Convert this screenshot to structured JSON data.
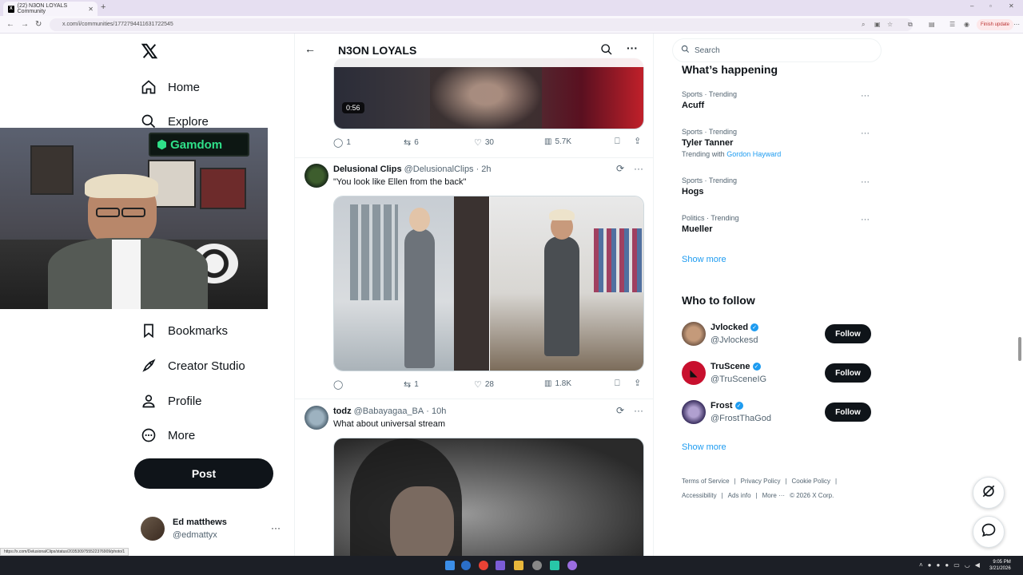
{
  "browser": {
    "tab_title": "(22) N3ON LOYALS Community",
    "url": "x.com/i/communities/1772794411631722545",
    "finish_update": "Finish update"
  },
  "nav": {
    "home": "Home",
    "explore": "Explore",
    "bookmarks": "Bookmarks",
    "creator_studio": "Creator Studio",
    "profile": "Profile",
    "more": "More",
    "post": "Post"
  },
  "account": {
    "name": "Ed matthews",
    "handle": "@edmattyx"
  },
  "webcam": {
    "sign_text": "Gamdom"
  },
  "community": {
    "title": "N3ON LOYALS"
  },
  "tweets": [
    {
      "video_duration": "0:56",
      "replies": "1",
      "reposts": "6",
      "likes": "30",
      "views": "5.7K"
    },
    {
      "name": "Delusional Clips",
      "handle": "@DelusionalClips",
      "time": "· 2h",
      "text": "\"You look like Ellen from the back\"",
      "replies": "",
      "reposts": "1",
      "likes": "28",
      "views": "1.8K"
    },
    {
      "name": "todz",
      "handle": "@Babayagaa_BA",
      "time": "· 10h",
      "text": "What about universal stream"
    }
  ],
  "search": {
    "placeholder": "Search"
  },
  "whats_happening": {
    "title": "What’s happening",
    "trends": [
      {
        "category": "Sports · Trending",
        "title": "Acuff"
      },
      {
        "category": "Sports · Trending",
        "title": "Tyler Tanner",
        "with_prefix": "Trending with",
        "with": "Gordon Hayward"
      },
      {
        "category": "Sports · Trending",
        "title": "Hogs"
      },
      {
        "category": "Politics · Trending",
        "title": "Mueller"
      }
    ],
    "show_more": "Show more"
  },
  "who_to_follow": {
    "title": "Who to follow",
    "accounts": [
      {
        "name": "Jvlocked",
        "handle": "@Jvlockesd",
        "button": "Follow"
      },
      {
        "name": "TruScene",
        "handle": "@TruSceneIG",
        "button": "Follow"
      },
      {
        "name": "Frost",
        "handle": "@FrostThaGod",
        "button": "Follow"
      }
    ],
    "show_more": "Show more"
  },
  "footer": {
    "links": [
      "Terms of Service",
      "Privacy Policy",
      "Cookie Policy",
      "Accessibility",
      "Ads info",
      "More ···",
      "© 2026 X Corp."
    ]
  },
  "status_url": "https://x.com/DelusionalClips/status/2035309755522376909/photo/1",
  "clock": {
    "time": "9:05 PM",
    "date": "3/21/2026"
  },
  "colors": {
    "accent": "#1d9bf0",
    "text": "#0f1419",
    "secondary": "#536471",
    "gamdom_green": "#2fe089"
  }
}
